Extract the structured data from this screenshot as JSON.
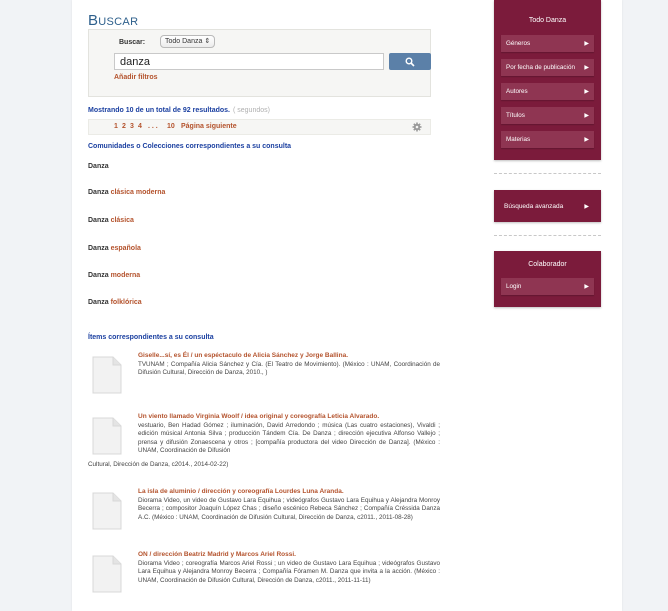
{
  "search": {
    "title": "Buscar",
    "scope_label": "Buscar:",
    "scope_value": "Todo Danza",
    "scope_arrow": "⇕",
    "query": "danza",
    "add_filters": "Añadir filtros"
  },
  "results": {
    "summary": "Mostrando 10 de un total de 92 resultados.",
    "seconds": "( segundos)",
    "pages": [
      "1",
      "2",
      "3",
      "4",
      ". . .",
      "10"
    ],
    "next": "Página siguiente"
  },
  "communities": {
    "heading": "Comunidades o Colecciones correspondientes a su consulta",
    "items": [
      {
        "bold": "Danza",
        "rest": ""
      },
      {
        "bold": "Danza",
        "rest": "clásica moderna"
      },
      {
        "bold": "Danza",
        "rest": "clásica"
      },
      {
        "bold": "Danza",
        "rest": "española"
      },
      {
        "bold": "Danza",
        "rest": "moderna"
      },
      {
        "bold": "Danza",
        "rest": "folklórica"
      }
    ]
  },
  "items": {
    "heading": "Ítems correspondientes a su consulta",
    "list": [
      {
        "title": "Giselle...sí, es Él / un espéctaculo de Alicia Sánchez y Jorge Ballina.",
        "desc": "TVUNAM ; Compañía Alicia Sánchez y Cía. (El Teatro de Movimiento). (México : UNAM, Coordinación de Difusión Cultural, Dirección de Danza, 2010., )"
      },
      {
        "title": "Un viento llamado Virginia Woolf / idea original y coreografía Leticia Alvarado.",
        "desc": "vestuario, Ben Hadad Gómez ; iluminación, David Arredondo ; música (Las cuatro estaciones), Vivaldi ; edición músical Antonia Silva ; producción Tándem Cía. De Danza ; dirección ejecutiva Alfonso Vallejo ; prensa y difusión Zonaescena y otros ; [compañía productora del video Dirección de Danza]. (México : UNAM, Coordinación de Difusión",
        "overflow": "Cultural, Dirección de Danza, c2014., 2014-02-22)"
      },
      {
        "title": "La isla de aluminio / dirección y coreografía Lourdes Luna Aranda.",
        "desc": "Diorama Video, un video de Gustavo Lara Equihua ; videógrafos Gustavo Lara Equihua y Alejandra Monroy Becerra ; compositor Joaquín López Chas ; diseño escénico Rebeca Sánchez ; Compañía Créssida Danza A.C. (México : UNAM, Coordinación de Difusión Cultural, Dirección de Danza, c2011., 2011-08-28)"
      },
      {
        "title": "ON / dirección Beatriz Madrid y Marcos Ariel Rossi.",
        "desc": "Diorama Video ; coreografía Marcos Ariel Rossi ; un video de Gustavo Lara Equihua ; videógrafos Gustavo Lara Equihua y Alejandra Monroy Becerra ; Compañía Fóramen M. Danza que invita a la acción. (México : UNAM, Coordinación de Difusión Cultural, Dirección de Danza, c2011., 2011-11-11)"
      }
    ]
  },
  "sidebar": {
    "browse_title": "Todo Danza",
    "browse_items": [
      "Géneros",
      "Por fecha de publicación",
      "Autores",
      "Títulos",
      "Materias"
    ],
    "advanced": "Búsqueda avanzada",
    "collab_title": "Colaborador",
    "login": "Login",
    "arrow": "▶"
  },
  "colors": {
    "accent": "#7b1b3b",
    "link": "#b4532d",
    "heading": "#1a3fa0",
    "button": "#5b80a8"
  }
}
